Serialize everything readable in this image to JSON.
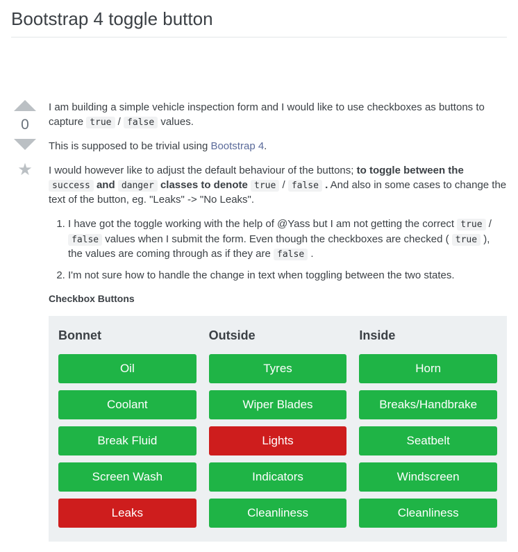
{
  "title": "Bootstrap 4 toggle button",
  "vote": {
    "score": "0"
  },
  "intro": {
    "p1a": "I am building a simple vehicle inspection form and I would like to use checkboxes as buttons to capture ",
    "code1": "true",
    "slash": " / ",
    "code2": "false",
    "p1b": " values.",
    "p2a": "This is supposed to be trivial using ",
    "link": "Bootstrap 4",
    "p2b": ".",
    "p3a": "I would however like to adjust the default behaviour of the buttons; ",
    "bold1": "to toggle between the ",
    "code_success": "success",
    "bold_and": " and ",
    "code_danger": "danger",
    "bold2": " classes to denote ",
    "code_true2": "true",
    "slash2": " / ",
    "code_false2": "false",
    "bold_dot": " .",
    "p3b": " And also in some cases to change the text of the button, eg. \"Leaks\" -> \"No Leaks\"."
  },
  "list": {
    "li1a": "I have got the toggle working with the help of @Yass but I am not getting the correct ",
    "li1_code1": "true",
    "li1_slash": " / ",
    "li1_code2": "false",
    "li1b": " values when I submit the form. Even though the checkboxes are checked ( ",
    "li1_code3": "true",
    "li1c": " ), the values are coming through as if they are ",
    "li1_code4": "false",
    "li1d": " .",
    "li2": "I'm not sure how to handle the change in text when toggling between the two states."
  },
  "panel_label": "Checkbox Buttons",
  "columns": [
    {
      "head": "Bonnet",
      "buttons": [
        {
          "label": "Oil",
          "state": "green"
        },
        {
          "label": "Coolant",
          "state": "green"
        },
        {
          "label": "Break Fluid",
          "state": "green"
        },
        {
          "label": "Screen Wash",
          "state": "green"
        },
        {
          "label": "Leaks",
          "state": "red"
        }
      ]
    },
    {
      "head": "Outside",
      "buttons": [
        {
          "label": "Tyres",
          "state": "green"
        },
        {
          "label": "Wiper Blades",
          "state": "green"
        },
        {
          "label": "Lights",
          "state": "red"
        },
        {
          "label": "Indicators",
          "state": "green"
        },
        {
          "label": "Cleanliness",
          "state": "green"
        }
      ]
    },
    {
      "head": "Inside",
      "buttons": [
        {
          "label": "Horn",
          "state": "green"
        },
        {
          "label": "Breaks/Handbrake",
          "state": "green"
        },
        {
          "label": "Seatbelt",
          "state": "green"
        },
        {
          "label": "Windscreen",
          "state": "green"
        },
        {
          "label": "Cleanliness",
          "state": "green"
        }
      ]
    }
  ]
}
